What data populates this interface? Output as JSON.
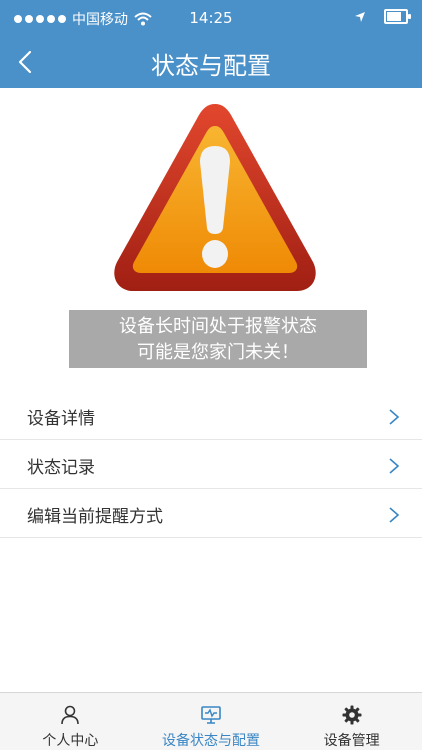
{
  "status_bar": {
    "carrier": "中国移动",
    "time": "14:25",
    "battery_level": 0.85
  },
  "nav": {
    "title": "状态与配置",
    "back_icon": "chevron-left-icon"
  },
  "alert": {
    "icon": "warning-triangle-icon",
    "line1": "设备长时间处于报警状态",
    "line2": "可能是您家门未关！"
  },
  "menu": {
    "items": [
      {
        "label": "设备详情"
      },
      {
        "label": "状态记录"
      },
      {
        "label": "编辑当前提醒方式"
      }
    ]
  },
  "tabs": [
    {
      "label": "个人中心",
      "icon": "person-icon",
      "active": false
    },
    {
      "label": "设备状态与配置",
      "icon": "monitor-icon",
      "active": true
    },
    {
      "label": "设备管理",
      "icon": "gear-icon",
      "active": false
    }
  ],
  "colors": {
    "header": "#4a90c9",
    "active_tab": "#3a86c4",
    "alert_box": "#a9a9a9"
  }
}
